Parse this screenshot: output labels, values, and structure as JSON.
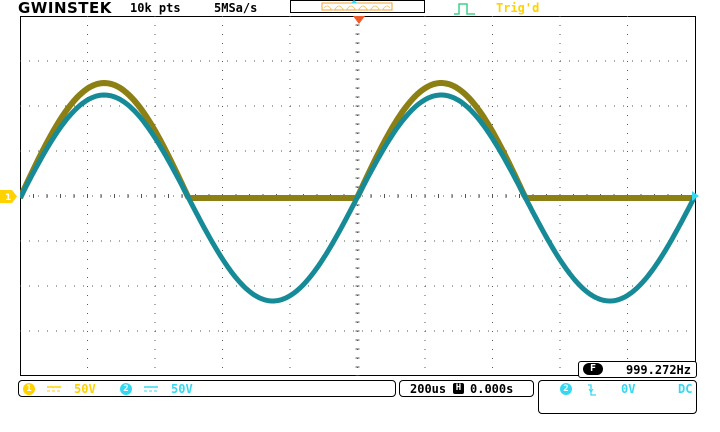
{
  "header": {
    "brand": "GWINSTEK",
    "record_length": "10k pts",
    "sample_rate": "5MSa/s",
    "trigger_status": "Trig'd"
  },
  "colors": {
    "ch1": "#8c7f14",
    "ch1_label": "#ffd200",
    "ch2": "#168a96",
    "ch2_label": "#36d8f0",
    "trigger_marker": "#f05a28",
    "grid": "#555555"
  },
  "measurement": {
    "badge": "F",
    "frequency": "999.272Hz"
  },
  "channels": [
    {
      "number": "1",
      "coupling_icon": "dc-coupling-icon",
      "scale": "50V"
    },
    {
      "number": "2",
      "coupling_icon": "dc-coupling-icon",
      "scale": "50V"
    }
  ],
  "timebase": {
    "scale": "200us",
    "h_badge": "H",
    "position": "0.000s"
  },
  "trigger": {
    "source": "2",
    "slope_icon": "falling-edge-icon",
    "level": "0V",
    "coupling": "DC"
  },
  "markers": {
    "ch1": "1"
  }
}
